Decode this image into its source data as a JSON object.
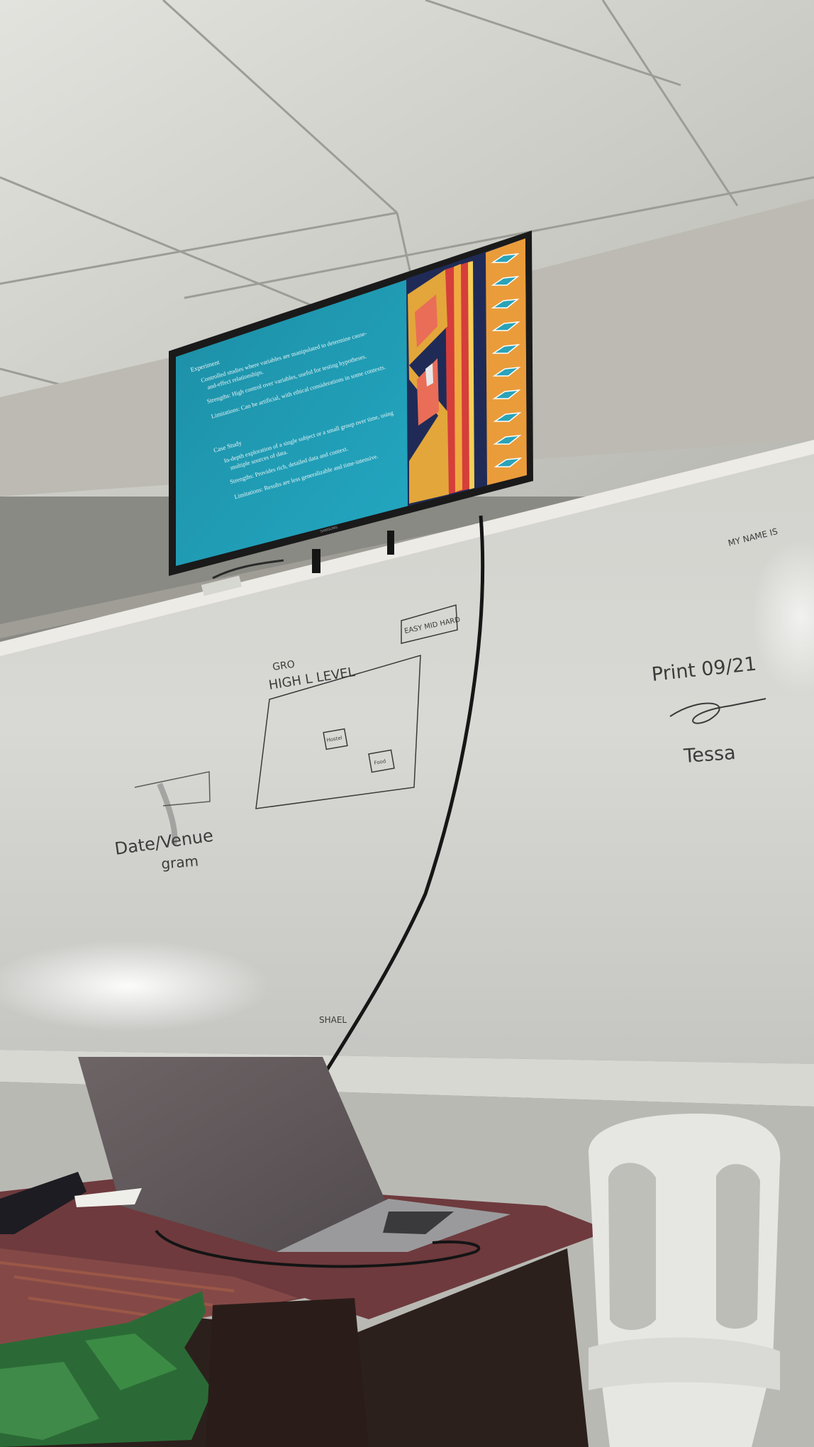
{
  "scene": {
    "tv": {
      "brand": "SAMSUNG",
      "slide": {
        "sections": [
          {
            "heading": "Experiment",
            "bullets": [
              "Controlled studies where variables are manipulated to determine cause-",
              "and-effect relationships.",
              "Strengths: High control over variables, useful for testing hypotheses.",
              "Limitations: Can be artificial, with ethical considerations in some contexts."
            ]
          },
          {
            "heading": "Case Study",
            "bullets": [
              "In-depth exploration of a single subject or a small group over time, using",
              "multiple sources of data.",
              "Strengths: Provides rich, detailed data and context.",
              "Limitations: Results are less generalizable and time-intensive."
            ]
          }
        ]
      }
    },
    "whiteboard": {
      "notes": {
        "name_line": "MY NAME IS",
        "print_line": "Print 09/21",
        "signature_name": "Tessa",
        "top_text": "GRO",
        "level_text": "HIGH   L  LEVEL",
        "box_text": "EASY\nMID\nHARD",
        "inner_box_1": "Hostel",
        "inner_box_2": "Food",
        "left_text_1": "Date/Venue",
        "left_text_2": "gram",
        "bottom_text": "SHAEL"
      }
    },
    "colors": {
      "ceiling": "#d9d9d4",
      "wall": "#bdbbb4",
      "whiteboard": "#e6e6e2",
      "tv_screen": "#21a3bd",
      "tv_dark_panel": "#202c57",
      "accent_orange": "#e8a12f",
      "accent_salmon": "#ec7d63",
      "table_cloth": "#6d3c3c",
      "laptop": "#6b6263",
      "chair": "#e8e8e4"
    }
  }
}
